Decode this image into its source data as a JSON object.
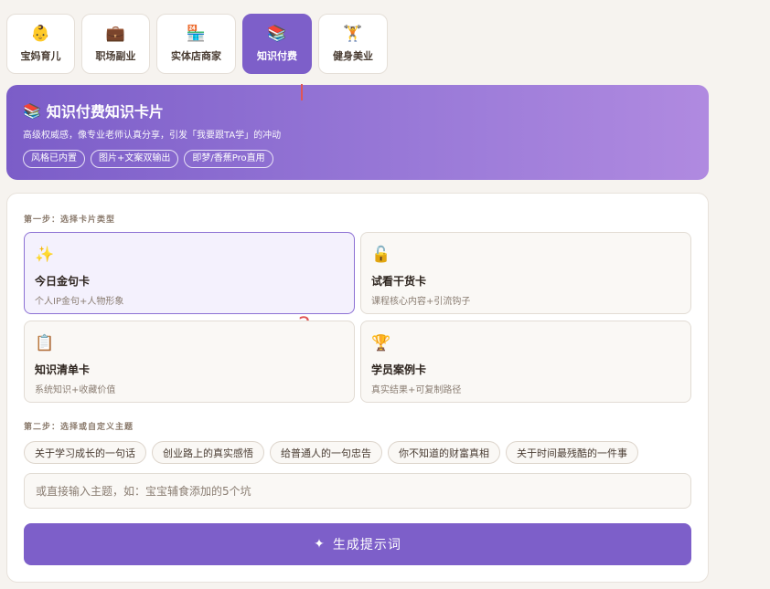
{
  "tabs": [
    {
      "icon": "👶",
      "label": "宝妈育儿"
    },
    {
      "icon": "💼",
      "label": "职场副业"
    },
    {
      "icon": "🏪",
      "label": "实体店商家"
    },
    {
      "icon": "📚",
      "label": "知识付费",
      "active": true
    },
    {
      "icon": "🏋",
      "label": "健身美业"
    }
  ],
  "hero": {
    "icon": "📚",
    "title": "知识付费知识卡片",
    "subtitle": "高级权威感，像专业老师认真分享，引发「我要跟TA学」的冲动",
    "chips": [
      "风格已内置",
      "图片+文案双输出",
      "即梦/香蕉Pro直用"
    ]
  },
  "annotations": {
    "marker_1": "1",
    "marker_2": "2"
  },
  "step1": {
    "title": "第一步：选择卡片类型",
    "cards": [
      {
        "icon": "✨",
        "title": "今日金句卡",
        "desc": "个人IP金句+人物形象",
        "selected": true
      },
      {
        "icon": "🔓",
        "title": "试看干货卡",
        "desc": "课程核心内容+引流钩子"
      },
      {
        "icon": "📋",
        "title": "知识清单卡",
        "desc": "系统知识+收藏价值"
      },
      {
        "icon": "🏆",
        "title": "学员案例卡",
        "desc": "真实结果+可复制路径"
      }
    ]
  },
  "step2": {
    "title": "第二步：选择或自定义主题",
    "topics": [
      "关于学习成长的一句话",
      "创业路上的真实感悟",
      "给普通人的一句忠告",
      "你不知道的财富真相",
      "关于时间最残酷的一件事"
    ],
    "input_placeholder": "或直接输入主题，如：宝宝辅食添加的5个坑",
    "input_value": ""
  },
  "generate": {
    "icon": "✦",
    "label": "生成提示词"
  },
  "colors": {
    "accent": "#7d5fc9",
    "background": "#f6f3ef",
    "marker": "#e05555"
  }
}
